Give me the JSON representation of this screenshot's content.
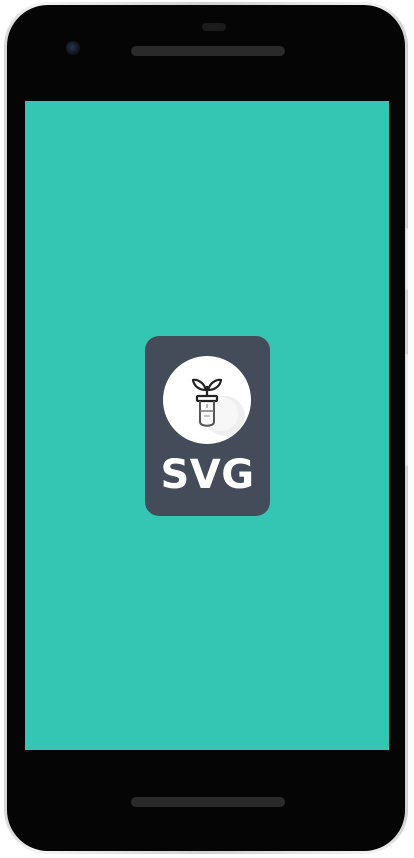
{
  "app_icon": {
    "label": "SVG",
    "icon": "plant-test-tube-icon"
  },
  "colors": {
    "screen_background": "#35c6b3",
    "icon_card": "#444c59",
    "icon_circle": "#ffffff",
    "phone_body": "#050505",
    "phone_frame": "#d8d8d8"
  }
}
